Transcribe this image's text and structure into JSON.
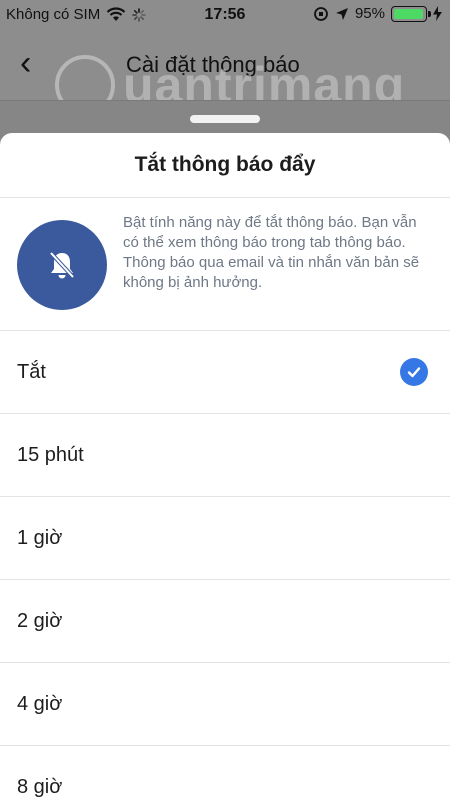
{
  "status_bar": {
    "carrier": "Không có SIM",
    "time": "17:56",
    "battery_percent": "95%",
    "battery_level": 0.95
  },
  "background": {
    "nav_title": "Cài đặt thông báo",
    "watermark": "uantrimang"
  },
  "sheet": {
    "title": "Tắt thông báo đẩy",
    "description": "Bật tính năng này để tắt thông báo. Bạn vẫn có thể xem thông báo trong tab thông báo. Thông báo qua email và tin nhắn văn bản sẽ không bị ảnh hưởng.",
    "icon": "bell-off-icon",
    "options": [
      {
        "label": "Tắt",
        "selected": true
      },
      {
        "label": "15 phút",
        "selected": false
      },
      {
        "label": "1 giờ",
        "selected": false
      },
      {
        "label": "2 giờ",
        "selected": false
      },
      {
        "label": "4 giờ",
        "selected": false
      },
      {
        "label": "8 giờ",
        "selected": false
      }
    ]
  },
  "colors": {
    "accent": "#3578e5",
    "icon_bg": "#3b5a9e",
    "battery": "#4cd964"
  }
}
